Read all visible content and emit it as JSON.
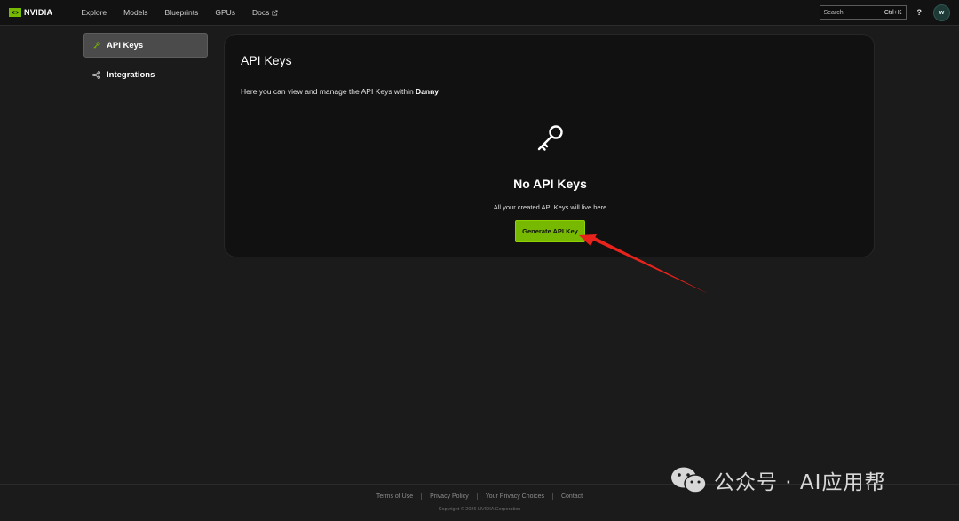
{
  "brand": {
    "name": "NVIDIA",
    "accent": "#76b900"
  },
  "nav": {
    "items": [
      {
        "label": "Explore"
      },
      {
        "label": "Models"
      },
      {
        "label": "Blueprints"
      },
      {
        "label": "GPUs"
      },
      {
        "label": "Docs",
        "icon": "external-link-icon"
      }
    ]
  },
  "topbar": {
    "search_placeholder": "Search",
    "search_shortcut": "Ctrl+K",
    "help_label": "?",
    "avatar_initial": "w"
  },
  "sidebar": {
    "items": [
      {
        "label": "API Keys",
        "icon": "key-icon",
        "active": true
      },
      {
        "label": "Integrations",
        "icon": "integrations-icon",
        "active": false
      }
    ]
  },
  "main": {
    "title": "API Keys",
    "description_prefix": "Here you can view and manage the API Keys within ",
    "org_name": "Danny",
    "empty_state": {
      "icon": "key-icon",
      "title": "No API Keys",
      "subtitle": "All your created API Keys will live here",
      "button_label": "Generate API Key"
    }
  },
  "annotation": {
    "color": "#e8231b",
    "icon": "red-arrow"
  },
  "footer": {
    "links": [
      "Terms of Use",
      "Privacy Policy",
      "Your Privacy Choices",
      "Contact"
    ],
    "copyright": "Copyright © 2026 NVIDIA Corporation"
  },
  "watermark": {
    "text": "公众号 · AI应用帮",
    "icon": "wechat-icon"
  }
}
